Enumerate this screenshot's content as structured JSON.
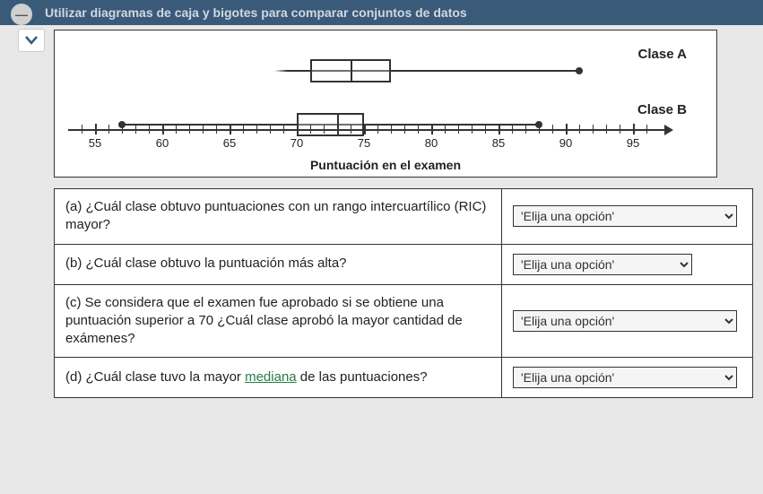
{
  "header": {
    "title": "Utilizar diagramas de caja y bigotes para comparar conjuntos de datos"
  },
  "chart_data": {
    "type": "boxplot",
    "xlabel": "Puntuación en el examen",
    "xlim": [
      53,
      97
    ],
    "ticks": [
      55,
      60,
      65,
      70,
      75,
      80,
      85,
      90,
      95
    ],
    "series": [
      {
        "name": "Clase A",
        "min": 68,
        "q1": 71,
        "median": 74,
        "q3": 77,
        "max": 91
      },
      {
        "name": "Clase B",
        "min": 57,
        "q1": 70,
        "median": 73,
        "q3": 75,
        "max": 88
      }
    ]
  },
  "questions": {
    "a": {
      "label": "(a)",
      "text": "¿Cuál clase obtuvo puntuaciones con un rango intercuartílico (RIC) mayor?",
      "placeholder": "'Elija una opción'"
    },
    "b": {
      "label": "(b)",
      "text": "¿Cuál clase obtuvo la puntuación más alta?",
      "placeholder": "'Elija una opción'"
    },
    "c": {
      "label": "(c)",
      "text": "Se considera que el examen fue aprobado si se obtiene una puntuación superior a 70 ¿Cuál clase aprobó la mayor cantidad de exámenes?",
      "placeholder": "'Elija una opción'"
    },
    "d": {
      "label": "(d)",
      "text_prefix": "¿Cuál clase tuvo la mayor ",
      "text_link": "mediana",
      "text_suffix": " de las puntuaciones?",
      "placeholder": "'Elija una opción'"
    }
  }
}
